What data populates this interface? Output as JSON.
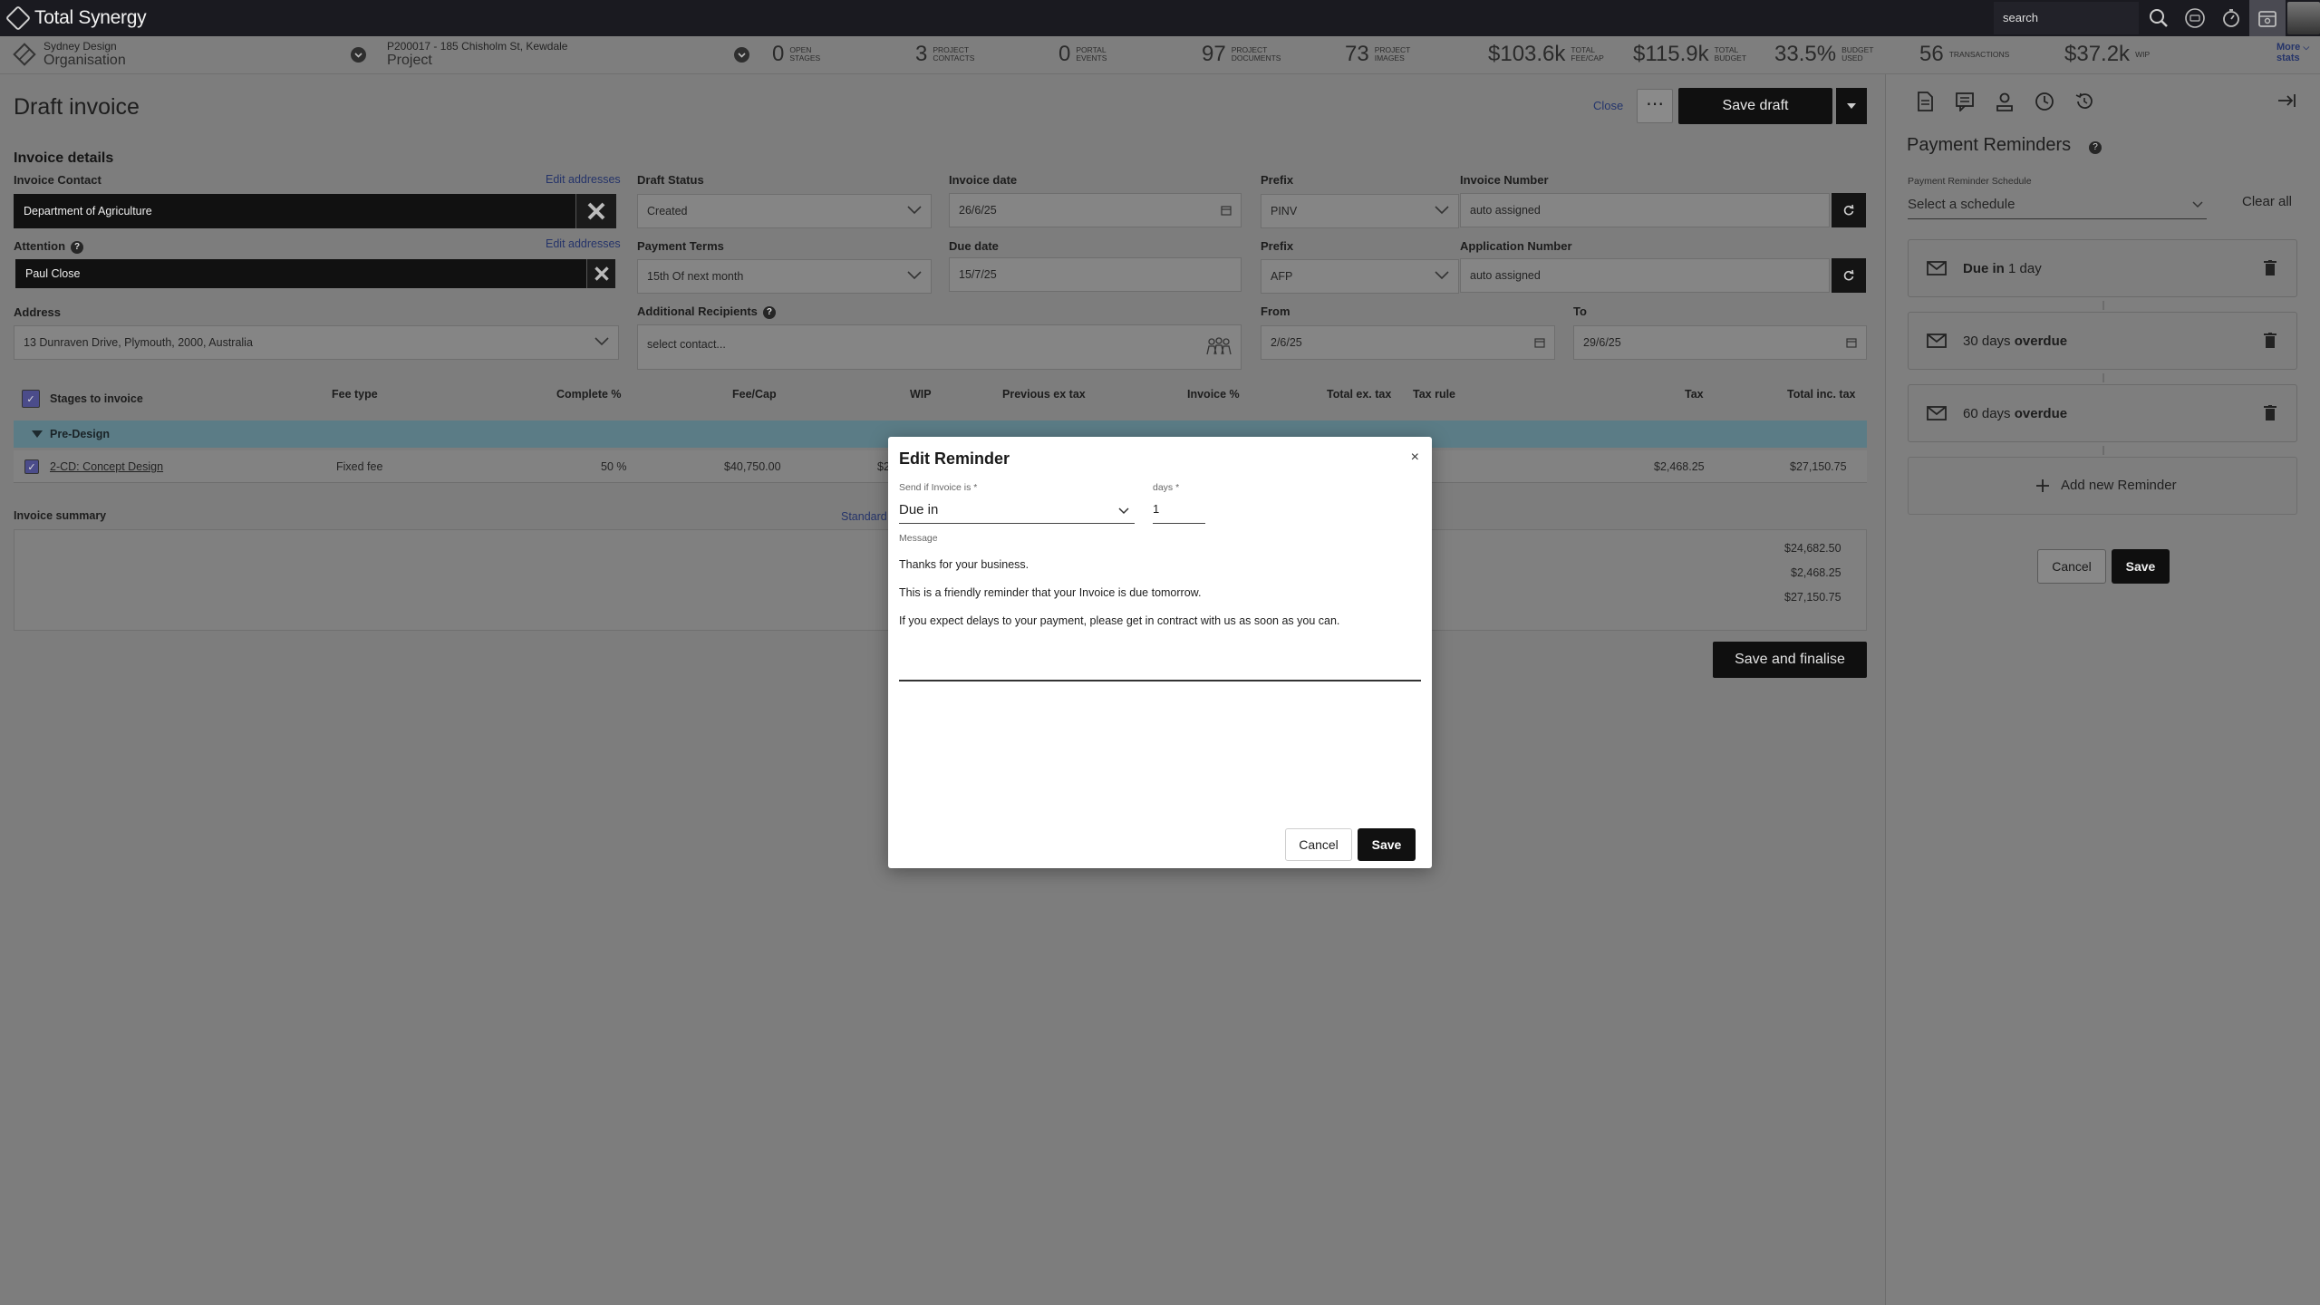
{
  "app": {
    "name": "Total Synergy",
    "search_placeholder": "search"
  },
  "context": {
    "org_label": "Sydney Design",
    "org_type": "Organisation",
    "project_label": "P200017 - 185 Chisholm St, Kewdale",
    "project_type": "Project"
  },
  "stats": [
    {
      "num": "0",
      "line1": "OPEN",
      "line2": "STAGES"
    },
    {
      "num": "3",
      "line1": "PROJECT",
      "line2": "CONTACTS"
    },
    {
      "num": "0",
      "line1": "PORTAL",
      "line2": "EVENTS"
    },
    {
      "num": "97",
      "line1": "PROJECT",
      "line2": "DOCUMENTS"
    },
    {
      "num": "73",
      "line1": "PROJECT",
      "line2": "IMAGES"
    },
    {
      "num": "$103.6k",
      "line1": "TOTAL",
      "line2": "FEE/CAP"
    },
    {
      "num": "$115.9k",
      "line1": "TOTAL",
      "line2": "BUDGET"
    },
    {
      "num": "33.5%",
      "line1": "BUDGET",
      "line2": "USED"
    },
    {
      "num": "56",
      "line1": "TRANSACTIONS",
      "line2": ""
    },
    {
      "num": "$37.2k",
      "line1": "WIP",
      "line2": ""
    }
  ],
  "more_stats": {
    "line1": "More",
    "line2": "stats"
  },
  "header": {
    "title": "Draft invoice",
    "close": "Close",
    "ellipsis": "⋯",
    "save_draft": "Save draft"
  },
  "invoice": {
    "section_title": "Invoice details",
    "contact_label": "Invoice Contact",
    "edit_addresses": "Edit addresses",
    "contact_value": "Department of Agriculture",
    "attention_label": "Attention",
    "attention_value": "Paul Close",
    "address_label": "Address",
    "address_value": "13 Dunraven Drive, Plymouth, 2000, Australia",
    "draft_status_label": "Draft Status",
    "draft_status_value": "Created",
    "payment_terms_label": "Payment Terms",
    "payment_terms_value": "15th Of next month",
    "additional_recipients_label": "Additional Recipients",
    "additional_recipients_placeholder": "select contact...",
    "invoice_date_label": "Invoice date",
    "invoice_date_value": "26/6/25",
    "due_date_label": "Due date",
    "due_date_value": "15/7/25",
    "prefix_label": "Prefix",
    "prefix1_value": "PINV",
    "prefix2_value": "AFP",
    "invoice_number_label": "Invoice Number",
    "invoice_number_value": "auto assigned",
    "application_number_label": "Application Number",
    "application_number_value": "auto assigned",
    "from_label": "From",
    "from_value": "2/6/25",
    "to_label": "To",
    "to_value": "29/6/25"
  },
  "table": {
    "headers": {
      "stages": "Stages to invoice",
      "fee_type": "Fee type",
      "complete": "Complete %",
      "fee_cap": "Fee/Cap",
      "wip": "WIP",
      "prev": "Previous ex tax",
      "invoice_pct": "Invoice %",
      "total_ex": "Total ex. tax",
      "tax_rule": "Tax rule",
      "tax": "Tax",
      "total_inc": "Total inc. tax"
    },
    "group": "Pre-Design",
    "row": {
      "stage": "2-CD: Concept Design",
      "fee_type": "Fixed fee",
      "complete": "50 %",
      "fee_cap": "$40,750.00",
      "wip_partial": "$2",
      "tax": "$2,468.25",
      "total_inc": "$27,150.75"
    }
  },
  "summary": {
    "title": "Invoice summary",
    "standard_partial": "Standard",
    "values": [
      "$24,682.50",
      "$2,468.25",
      "$27,150.75"
    ],
    "finalise": "Save and finalise"
  },
  "reminders": {
    "title": "Payment Reminders",
    "schedule_label": "Payment Reminder Schedule",
    "schedule_placeholder": "Select a schedule",
    "clear_all": "Clear all",
    "items": [
      {
        "prefix": "Due in",
        "bold": "1 day",
        "order": "prefix-first"
      },
      {
        "prefix": "30 days",
        "bold": "overdue",
        "order": "plain-first"
      },
      {
        "prefix": "60 days",
        "bold": "overdue",
        "order": "plain-first"
      }
    ],
    "add": "Add new Reminder",
    "cancel": "Cancel",
    "save": "Save"
  },
  "modal": {
    "title": "Edit Reminder",
    "close": "×",
    "send_label": "Send if Invoice is *",
    "send_value": "Due in",
    "days_label": "days *",
    "days_value": "1",
    "message_label": "Message",
    "message_lines": [
      "Thanks for your business.",
      "This is a friendly reminder that your Invoice is due tomorrow.",
      "If you expect delays to your payment, please get in contract with us as soon as you can."
    ],
    "cancel": "Cancel",
    "save": "Save"
  }
}
